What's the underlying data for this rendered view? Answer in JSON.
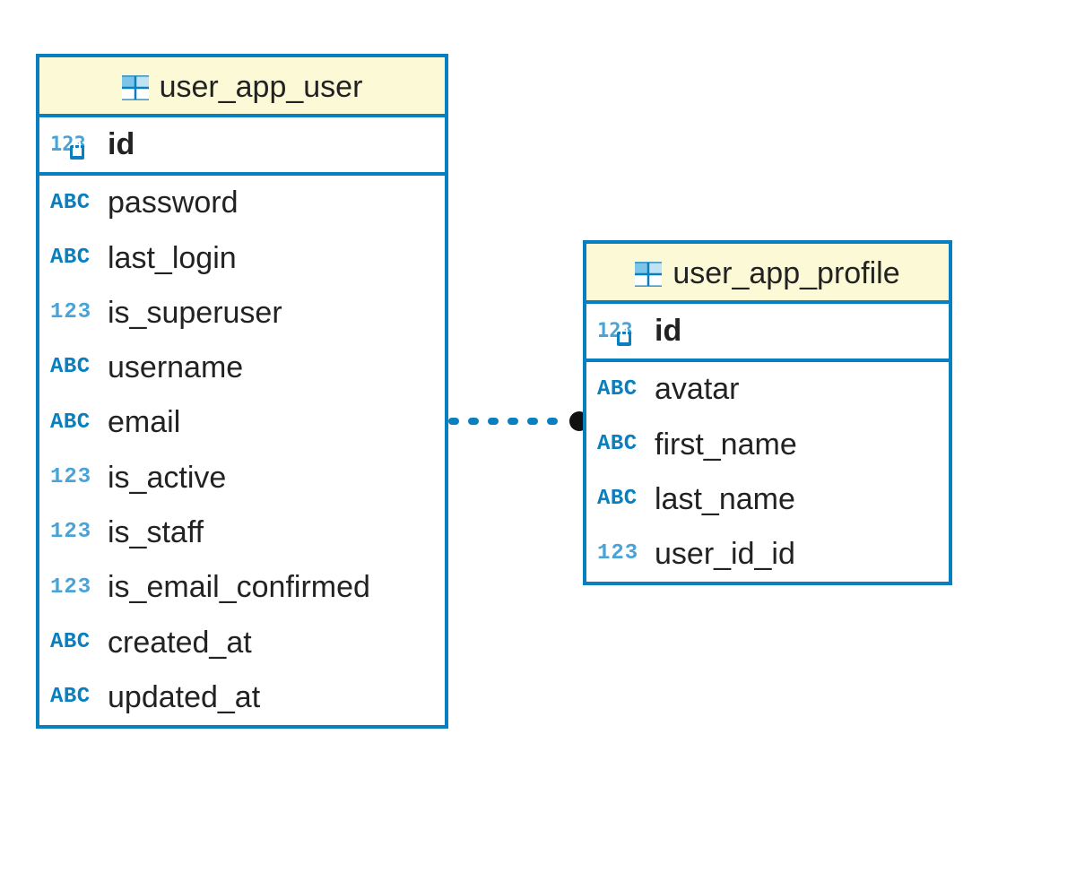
{
  "colors": {
    "border": "#0a7fbf",
    "header_bg": "#fbf9d6",
    "icon_blue": "#0a7fbf",
    "icon_light": "#4aa3d6",
    "relation": "#0a7fbf"
  },
  "tables": {
    "user": {
      "title": "user_app_user",
      "pk": {
        "type": "pk_num",
        "name": "id"
      },
      "columns": [
        {
          "type": "text",
          "name": "password"
        },
        {
          "type": "text",
          "name": "last_login"
        },
        {
          "type": "num",
          "name": "is_superuser"
        },
        {
          "type": "text",
          "name": "username"
        },
        {
          "type": "text",
          "name": "email"
        },
        {
          "type": "num",
          "name": "is_active"
        },
        {
          "type": "num",
          "name": "is_staff"
        },
        {
          "type": "num",
          "name": "is_email_confirmed"
        },
        {
          "type": "text",
          "name": "created_at"
        },
        {
          "type": "text",
          "name": "updated_at"
        }
      ]
    },
    "profile": {
      "title": "user_app_profile",
      "pk": {
        "type": "pk_num",
        "name": "id"
      },
      "columns": [
        {
          "type": "text",
          "name": "avatar"
        },
        {
          "type": "text",
          "name": "first_name"
        },
        {
          "type": "text",
          "name": "last_name"
        },
        {
          "type": "num",
          "name": "user_id_id"
        }
      ]
    }
  },
  "relationship": {
    "from_table": "user_app_user",
    "to_table": "user_app_profile",
    "style": "dashed",
    "end_marker": "dot"
  }
}
